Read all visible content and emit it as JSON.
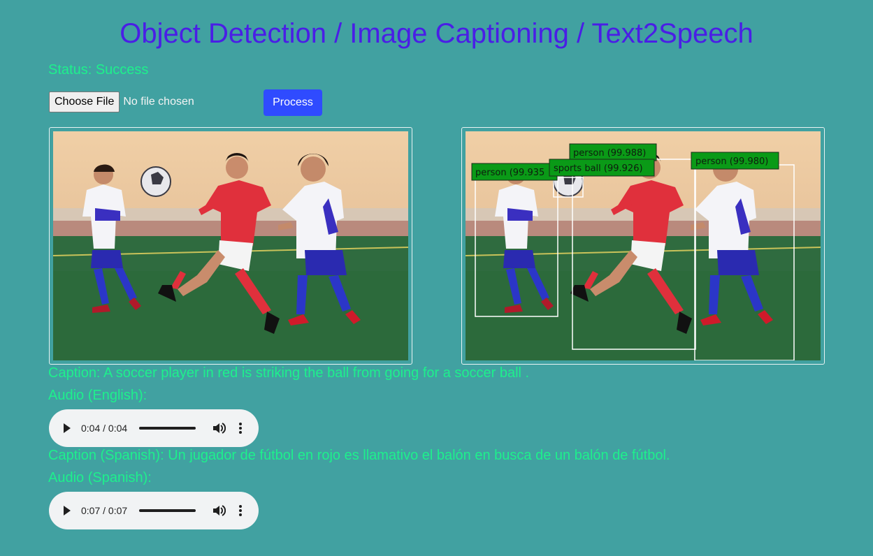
{
  "header": {
    "title": "Object Detection / Image Captioning / Text2Speech"
  },
  "status": {
    "text": "Status: Success"
  },
  "upload": {
    "choose_label": "Choose File",
    "file_status": "No file chosen",
    "process_label": "Process"
  },
  "images": {
    "input_alt": "input image",
    "output_alt": "detection output",
    "detections": [
      {
        "label": "person (99.935"
      },
      {
        "label": "sports ball (99.926)"
      },
      {
        "label": "person (99.988)"
      },
      {
        "label": "person (99.980)"
      }
    ]
  },
  "captions": {
    "english": "Caption: A soccer player in red is striking the ball from going for a soccer ball .",
    "audio_english_label": "Audio (English):",
    "spanish": "Caption (Spanish): Un jugador de fútbol en rojo es llamativo el balón en busca de un balón de fútbol.",
    "audio_spanish_label": "Audio (Spanish):"
  },
  "audio_players": [
    {
      "time": "0:04 / 0:04"
    },
    {
      "time": "0:07 / 0:07"
    }
  ],
  "colors": {
    "background": "#41a1a1",
    "title": "#4a1ee6",
    "text": "#1ef08c",
    "process_button": "#2f4bff",
    "detection_box": "#ffffff",
    "detection_label_bg": "#0a9a17"
  }
}
